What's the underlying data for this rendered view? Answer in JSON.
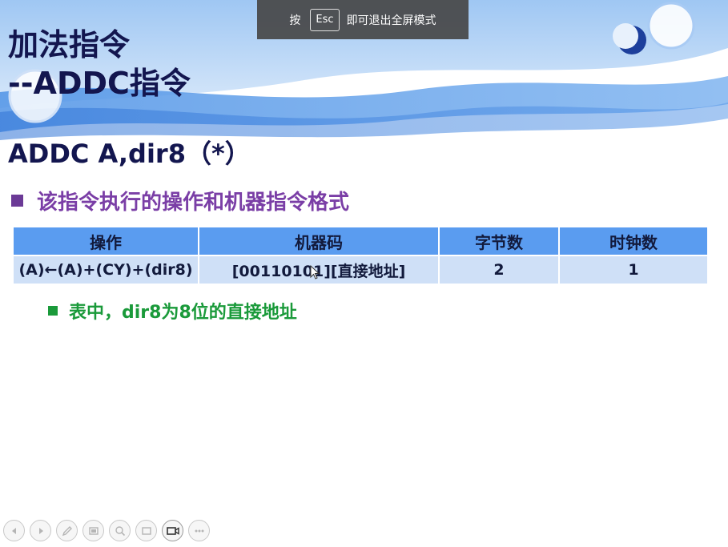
{
  "slide": {
    "title_line1": "加法指令",
    "title_line2": "--ADDC指令",
    "instruction": "ADDC A,dir8（*）",
    "bullet_heading": "该指令执行的操作和机器指令格式",
    "table": {
      "headers": [
        "操作",
        "机器码",
        "字节数",
        "时钟数"
      ],
      "row": [
        "(A)←(A)+(CY)+(dir8)",
        "[00110101][直接地址]",
        "2",
        "1"
      ]
    },
    "note": "表中，dir8为8位的直接地址"
  },
  "fullscreen_hint": {
    "prefix": "按",
    "key": "Esc",
    "suffix": "即可退出全屏模式"
  },
  "toolbar": {
    "icons": [
      "previous-icon",
      "next-icon",
      "pen-icon",
      "slides-icon",
      "zoom-icon",
      "screen-icon",
      "camera-icon",
      "more-icon"
    ]
  },
  "colors": {
    "title": "#13164f",
    "bullet": "#7a3ea6",
    "table_header": "#5a9cf0",
    "table_row": "#cfe0f7",
    "note": "#1a9a3a"
  }
}
